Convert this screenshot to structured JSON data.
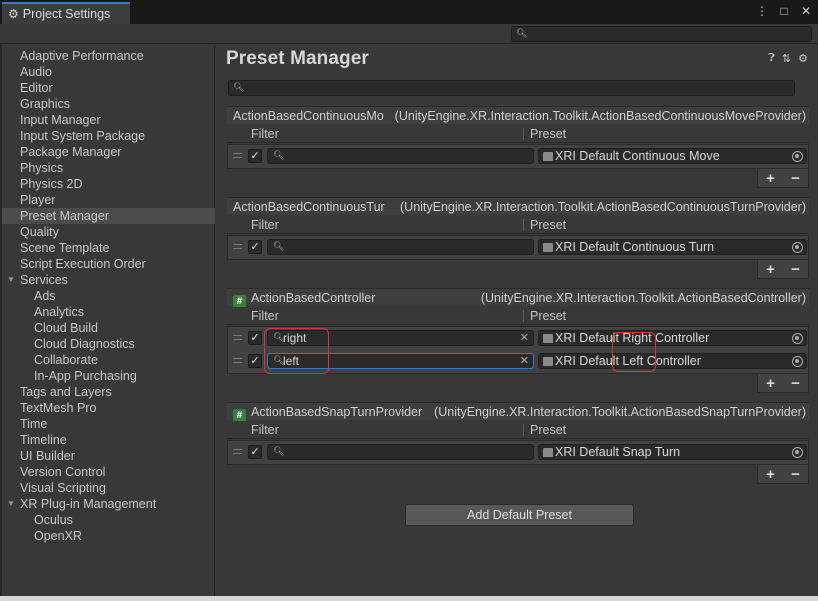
{
  "window": {
    "tab_title": "Project Settings",
    "controls": [
      "⋮",
      "□",
      "✕"
    ]
  },
  "sidebar": {
    "items": [
      {
        "label": "Adaptive Performance",
        "indent": 0
      },
      {
        "label": "Audio",
        "indent": 0
      },
      {
        "label": "Editor",
        "indent": 0
      },
      {
        "label": "Graphics",
        "indent": 0
      },
      {
        "label": "Input Manager",
        "indent": 0
      },
      {
        "label": "Input System Package",
        "indent": 0
      },
      {
        "label": "Package Manager",
        "indent": 0
      },
      {
        "label": "Physics",
        "indent": 0
      },
      {
        "label": "Physics 2D",
        "indent": 0
      },
      {
        "label": "Player",
        "indent": 0
      },
      {
        "label": "Preset Manager",
        "indent": 0,
        "selected": true
      },
      {
        "label": "Quality",
        "indent": 0
      },
      {
        "label": "Scene Template",
        "indent": 0
      },
      {
        "label": "Script Execution Order",
        "indent": 0
      },
      {
        "label": "Services",
        "indent": 0,
        "expanded": true
      },
      {
        "label": "Ads",
        "indent": 1
      },
      {
        "label": "Analytics",
        "indent": 1
      },
      {
        "label": "Cloud Build",
        "indent": 1
      },
      {
        "label": "Cloud Diagnostics",
        "indent": 1
      },
      {
        "label": "Collaborate",
        "indent": 1
      },
      {
        "label": "In-App Purchasing",
        "indent": 1
      },
      {
        "label": "Tags and Layers",
        "indent": 0
      },
      {
        "label": "TextMesh Pro",
        "indent": 0
      },
      {
        "label": "Time",
        "indent": 0
      },
      {
        "label": "Timeline",
        "indent": 0
      },
      {
        "label": "UI Builder",
        "indent": 0
      },
      {
        "label": "Version Control",
        "indent": 0
      },
      {
        "label": "Visual Scripting",
        "indent": 0
      },
      {
        "label": "XR Plug-in Management",
        "indent": 0,
        "expanded": true
      },
      {
        "label": "Oculus",
        "indent": 1
      },
      {
        "label": "OpenXR",
        "indent": 1
      }
    ]
  },
  "main": {
    "title": "Preset Manager",
    "header_icons": [
      "help-icon",
      "sliders-icon",
      "gear-icon"
    ],
    "column_filter": "Filter",
    "column_preset": "Preset",
    "sections": [
      {
        "name": "ActionBasedContinuousMo",
        "type": "(UnityEngine.XR.Interaction.Toolkit.ActionBasedContinuousMoveProvider)",
        "script_icon": false,
        "rows": [
          {
            "filter": "",
            "preset": "XRI Default Continuous Move"
          }
        ]
      },
      {
        "name": "ActionBasedContinuousTurr",
        "type": "(UnityEngine.XR.Interaction.Toolkit.ActionBasedContinuousTurnProvider)",
        "script_icon": false,
        "rows": [
          {
            "filter": "",
            "preset": "XRI Default Continuous Turn"
          }
        ]
      },
      {
        "name": "ActionBasedController",
        "type": "(UnityEngine.XR.Interaction.Toolkit.ActionBasedController)",
        "script_icon": true,
        "rows": [
          {
            "filter": "right",
            "preset": "XRI Default Right Controller"
          },
          {
            "filter": "left",
            "preset": "XRI Default Left Controller",
            "focused": true
          }
        ]
      },
      {
        "name": "ActionBasedSnapTurnProvider",
        "type": "(UnityEngine.XR.Interaction.Toolkit.ActionBasedSnapTurnProvider)",
        "script_icon": true,
        "rows": [
          {
            "filter": "",
            "preset": "XRI Default Snap Turn"
          }
        ]
      }
    ],
    "add_button": "Add Default Preset",
    "plus": "+",
    "minus": "−",
    "script_glyph": "#"
  }
}
